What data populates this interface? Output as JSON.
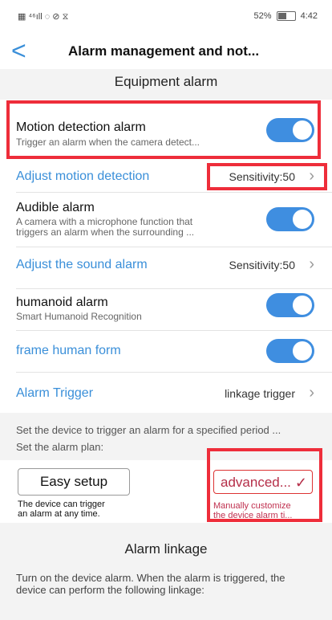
{
  "status": {
    "left_icons": "▦ ⁴⁶ıll ◌ ⊘ ⧖",
    "battery": "52%",
    "time": "4:42"
  },
  "header": {
    "back_glyph": "<",
    "title": "Alarm management and not..."
  },
  "equipment": {
    "section_title": "Equipment alarm"
  },
  "motion": {
    "label": "Motion detection alarm",
    "desc": "Trigger an alarm when the camera detect...",
    "toggle": true
  },
  "adjust_motion": {
    "label": "Adjust motion detection",
    "value": "Sensitivity:50"
  },
  "audible": {
    "label": "Audible alarm",
    "desc1": "A camera with a microphone function that",
    "desc2": "triggers an alarm when the surrounding ...",
    "toggle": true
  },
  "adjust_sound": {
    "label": "Adjust the sound alarm",
    "value": "Sensitivity:50"
  },
  "humanoid": {
    "label": "humanoid alarm",
    "desc": "Smart Humanoid Recognition",
    "toggle": true
  },
  "frame": {
    "label": "frame human form",
    "toggle": true
  },
  "trigger": {
    "label": "Alarm Trigger",
    "value": "linkage trigger"
  },
  "plan": {
    "note1": "Set the device to trigger an alarm for a specified period ...",
    "note2": "Set the alarm plan:",
    "easy_label": "Easy setup",
    "easy_desc1": "The device can trigger",
    "easy_desc2": "an alarm at any time.",
    "adv_label": "advanced...",
    "adv_desc1": "Manually customize",
    "adv_desc2": "the device alarm ti..."
  },
  "linkage": {
    "section_title": "Alarm linkage",
    "desc1": "Turn on the device alarm. When the alarm is triggered, the",
    "desc2": "device can perform the following linkage:"
  },
  "colors": {
    "accent": "#3a8fd9",
    "toggle_on": "#3f8ee0",
    "highlight": "#ee2d3a",
    "advanced": "#b52e48"
  }
}
